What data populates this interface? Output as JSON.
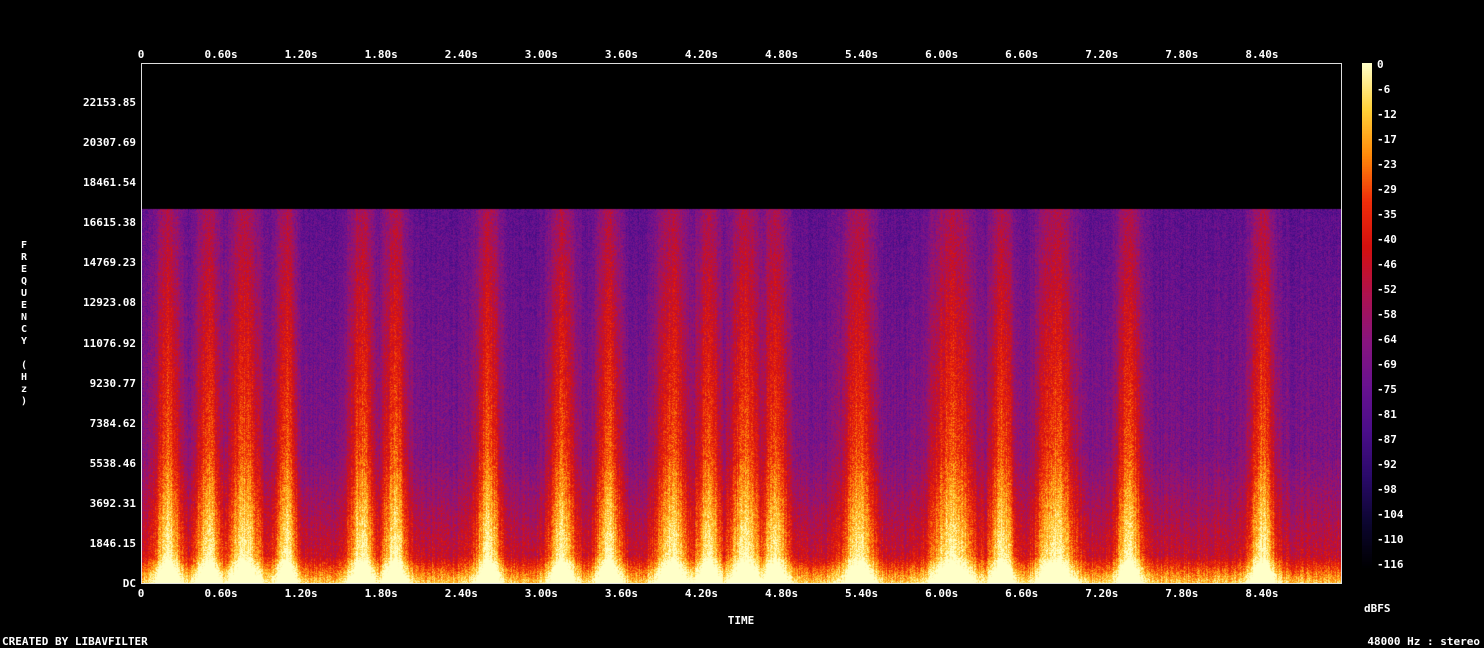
{
  "chart_data": {
    "type": "heatmap",
    "title": "",
    "xlabel": "TIME",
    "ylabel": "FREQUENCY (Hz)",
    "colorbar_label": "dBFS",
    "x_unit": "s",
    "xlim": [
      0,
      9.0
    ],
    "ylim": [
      0,
      24000
    ],
    "x_ticks": [
      "0",
      "0.60s",
      "1.20s",
      "1.80s",
      "2.40s",
      "3.00s",
      "3.60s",
      "4.20s",
      "4.80s",
      "5.40s",
      "6.00s",
      "6.60s",
      "7.20s",
      "7.80s",
      "8.40s"
    ],
    "x_tick_values": [
      0,
      0.6,
      1.2,
      1.8,
      2.4,
      3.0,
      3.6,
      4.2,
      4.8,
      5.4,
      6.0,
      6.6,
      7.2,
      7.8,
      8.4
    ],
    "y_ticks": [
      "DC",
      "1846.15",
      "3692.31",
      "5538.46",
      "7384.62",
      "9230.77",
      "11076.92",
      "12923.08",
      "14769.23",
      "16615.38",
      "18461.54",
      "20307.69",
      "22153.85"
    ],
    "y_tick_values": [
      0,
      1846.15,
      3692.31,
      5538.46,
      7384.62,
      9230.77,
      11076.92,
      12923.08,
      14769.23,
      16615.38,
      18461.54,
      20307.69,
      22153.85
    ],
    "colorbar_ticks": [
      "0",
      "-6",
      "-12",
      "-17",
      "-23",
      "-29",
      "-35",
      "-40",
      "-46",
      "-52",
      "-58",
      "-64",
      "-69",
      "-75",
      "-81",
      "-87",
      "-92",
      "-98",
      "-104",
      "-110",
      "-116"
    ],
    "cutoff_frequency_hz": 17300,
    "loud_segments_s": [
      [
        0.15,
        0.25
      ],
      [
        0.45,
        0.55
      ],
      [
        0.7,
        0.85
      ],
      [
        1.05,
        1.12
      ],
      [
        1.6,
        1.7
      ],
      [
        1.85,
        1.95
      ],
      [
        2.55,
        2.65
      ],
      [
        3.1,
        3.2
      ],
      [
        3.45,
        3.55
      ],
      [
        3.9,
        4.05
      ],
      [
        4.2,
        4.3
      ],
      [
        4.45,
        4.6
      ],
      [
        4.7,
        4.8
      ],
      [
        5.3,
        5.45
      ],
      [
        5.95,
        6.2
      ],
      [
        6.4,
        6.5
      ],
      [
        6.75,
        6.95
      ],
      [
        7.35,
        7.45
      ],
      [
        8.35,
        8.45
      ]
    ],
    "colormap": [
      "#000000",
      "#0c0630",
      "#2a0a6a",
      "#4b0e8a",
      "#6a1290",
      "#8a157e",
      "#b0124e",
      "#d4100f",
      "#f02e0a",
      "#ff8a0a",
      "#ffd23a",
      "#ffffc8"
    ]
  },
  "footer": {
    "left": "CREATED BY LIBAVFILTER",
    "right": "48000 Hz : stereo"
  }
}
